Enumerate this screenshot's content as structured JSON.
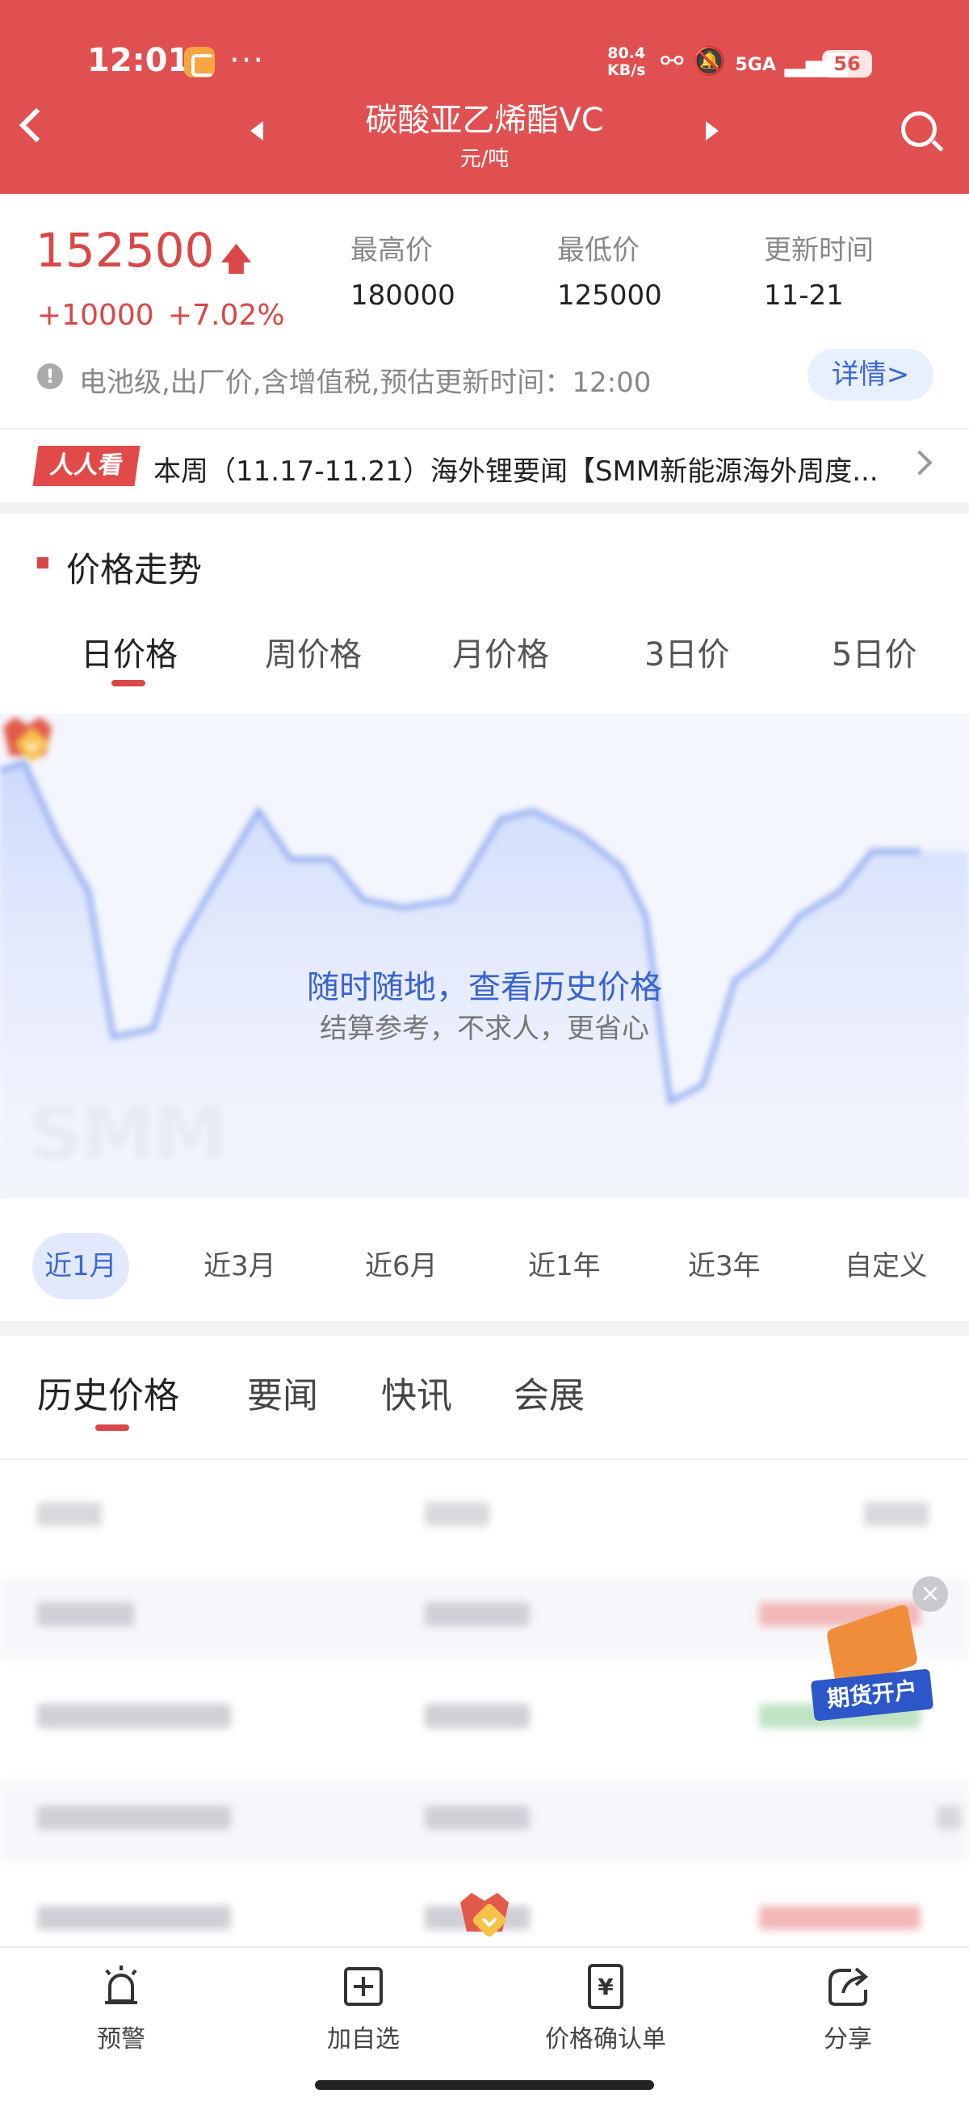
{
  "status_bar": {
    "time": "12:01",
    "dots": "···",
    "net_speed_top": "80.4",
    "net_speed_bottom": "KB/s",
    "signal": "5GA",
    "battery": "56"
  },
  "header": {
    "title": "碳酸亚乙烯酯VC",
    "unit": "元/吨"
  },
  "price": {
    "current": "152500",
    "change": "+10000",
    "change_pct": "+7.02%",
    "stats": [
      {
        "label": "最高价",
        "value": "180000"
      },
      {
        "label": "最低价",
        "value": "125000"
      },
      {
        "label": "更新时间",
        "value": "11-21"
      }
    ],
    "note_icon": "!",
    "note": "电池级,出厂价,含增值税,预估更新时间：12:00",
    "detail_button": "详情>"
  },
  "news": {
    "badge": "人人看",
    "text": "本周（11.17-11.21）海外锂要闻【SMM新能源海外周度..."
  },
  "trend": {
    "section_title": "价格走势",
    "period_tabs": [
      "日价格",
      "周价格",
      "月价格",
      "3日价",
      "5日价"
    ],
    "chart_watermark": "SMM",
    "overlay_title": "随时随地，查看历史价格",
    "overlay_subtitle": "结算参考，不求人，更省心",
    "range_tabs": [
      "近1月",
      "近3月",
      "近6月",
      "近1年",
      "近3年",
      "自定义"
    ],
    "accent_color": "#3e68d3"
  },
  "history": {
    "tabs": [
      "历史价格",
      "要闻",
      "快讯",
      "会展"
    ],
    "promo_label": "期货开户",
    "promo_close": "×"
  },
  "bottom_nav": [
    {
      "label": "预警",
      "icon": "alarm-icon"
    },
    {
      "label": "加自选",
      "icon": "add-favorite-icon"
    },
    {
      "label": "价格确认单",
      "icon": "price-confirm-icon"
    },
    {
      "label": "分享",
      "icon": "share-icon"
    }
  ],
  "colors": {
    "brand_red": "#e15050",
    "price_red": "#d94848",
    "link_blue": "#3e68d3"
  }
}
